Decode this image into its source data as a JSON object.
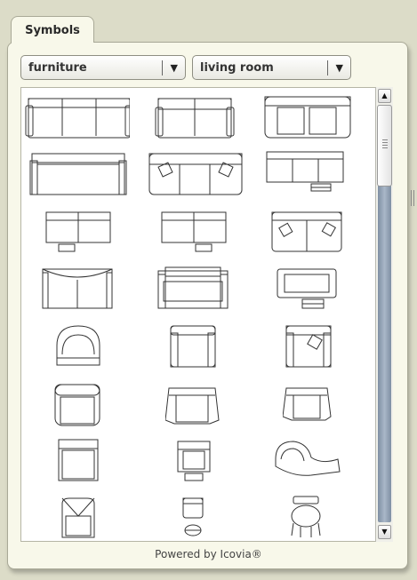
{
  "tab": {
    "label": "Symbols"
  },
  "filters": {
    "category": {
      "value": "furniture"
    },
    "room": {
      "value": "living room"
    }
  },
  "symbols": [
    {
      "name": "sofa-three-seat-a",
      "icon": "sofa-icon"
    },
    {
      "name": "loveseat-a",
      "icon": "loveseat-icon"
    },
    {
      "name": "sofa-rounded-a",
      "icon": "sofa-icon"
    },
    {
      "name": "sofa-long-a",
      "icon": "sofa-icon"
    },
    {
      "name": "sofa-pillows",
      "icon": "sofa-icon"
    },
    {
      "name": "sofa-with-table",
      "icon": "sofa-icon"
    },
    {
      "name": "loveseat-with-table",
      "icon": "loveseat-icon"
    },
    {
      "name": "loveseat-with-table-b",
      "icon": "loveseat-icon"
    },
    {
      "name": "loveseat-pillows",
      "icon": "loveseat-icon"
    },
    {
      "name": "loveseat-rounded",
      "icon": "loveseat-icon"
    },
    {
      "name": "daybed",
      "icon": "daybed-icon"
    },
    {
      "name": "chaise-with-table",
      "icon": "chaise-icon"
    },
    {
      "name": "round-armchair",
      "icon": "armchair-icon"
    },
    {
      "name": "club-chair",
      "icon": "armchair-icon"
    },
    {
      "name": "club-chair-pillow",
      "icon": "armchair-icon"
    },
    {
      "name": "tub-chair",
      "icon": "armchair-icon"
    },
    {
      "name": "wing-chair",
      "icon": "armchair-icon"
    },
    {
      "name": "wing-chair-b",
      "icon": "armchair-icon"
    },
    {
      "name": "side-chair",
      "icon": "chair-icon"
    },
    {
      "name": "chair-with-ottoman",
      "icon": "chair-icon"
    },
    {
      "name": "chaise-lounge",
      "icon": "chaise-icon"
    },
    {
      "name": "slipper-chair",
      "icon": "chair-icon"
    },
    {
      "name": "small-chair-with-stool",
      "icon": "chair-icon"
    },
    {
      "name": "bar-stool",
      "icon": "stool-icon"
    }
  ],
  "scrollbar": {
    "up_arrow": "▲",
    "down_arrow": "▼"
  },
  "footer": {
    "powered_by": "Powered by Icovia®"
  }
}
